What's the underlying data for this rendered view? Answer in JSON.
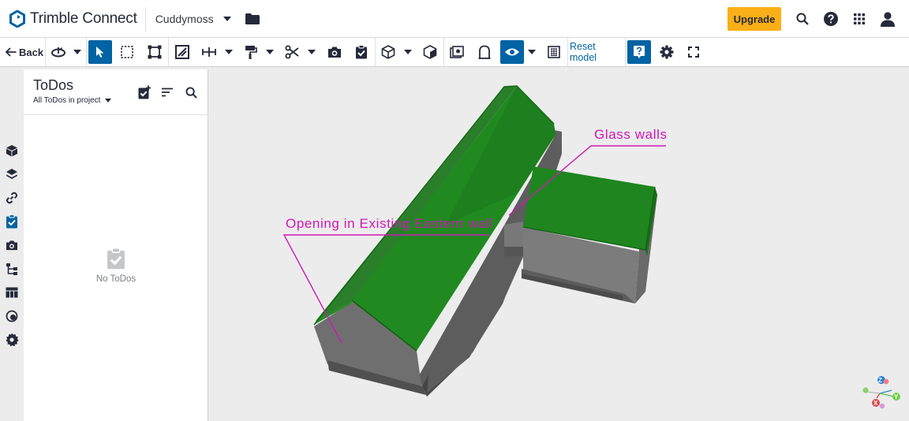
{
  "app": {
    "name": "Trimble Connect",
    "project": "Cuddymoss",
    "upgrade_label": "Upgrade"
  },
  "toolbar": {
    "back_label": "Back",
    "reset_label": "Reset model"
  },
  "panel": {
    "title": "ToDos",
    "filter": "All ToDos in project",
    "empty_text": "No ToDos"
  },
  "markups": {
    "glass_walls": "Glass walls",
    "opening": "Opening in Existing Eastern wall"
  },
  "axes": {
    "z": "Z",
    "y": "Y",
    "x": "X"
  },
  "colors": {
    "brand": "#0063a3",
    "upgrade": "#fbaf17",
    "markup": "#d017b7",
    "roof": "#1e7a1e",
    "wall": "#6b6b6b"
  }
}
